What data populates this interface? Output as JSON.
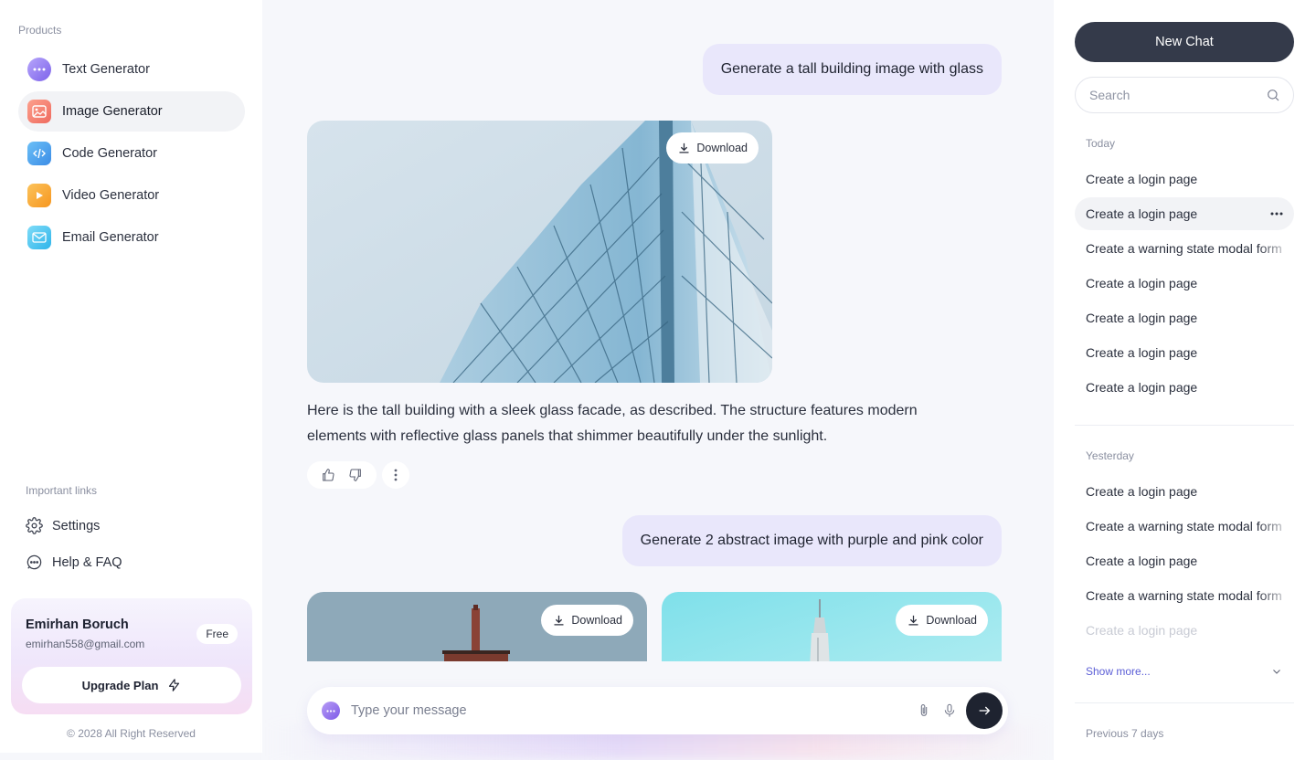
{
  "sidebar": {
    "products_heading": "Products",
    "items": [
      {
        "label": "Text Generator",
        "icon": "chat-bubble-icon",
        "color": "#8f7cf2"
      },
      {
        "label": "Image Generator",
        "icon": "image-icon",
        "color": "#f58a75"
      },
      {
        "label": "Code Generator",
        "icon": "code-icon",
        "color": "#4aa3f0"
      },
      {
        "label": "Video Generator",
        "icon": "video-play-icon",
        "color": "#f8a53a"
      },
      {
        "label": "Email Generator",
        "icon": "mail-icon",
        "color": "#47c4f0"
      }
    ],
    "links_heading": "Important links",
    "links": [
      {
        "label": "Settings",
        "icon": "gear-icon"
      },
      {
        "label": "Help & FAQ",
        "icon": "help-chat-icon"
      }
    ],
    "profile": {
      "name": "Emirhan Boruch",
      "email": "emirhan558@gmail.com",
      "plan": "Free",
      "upgrade_label": "Upgrade Plan"
    },
    "copyright": "© 2028 All Right Reserved"
  },
  "chat": {
    "messages": [
      {
        "role": "user",
        "text": "Generate a tall building image with glass"
      },
      {
        "role": "assistant",
        "text": "Here is the tall building with a sleek glass facade, as described. The structure features modern elements with reflective glass panels that shimmer beautifully under the sunlight."
      },
      {
        "role": "user",
        "text": "Generate 2 abstract image with purple and pink color"
      }
    ],
    "download_label": "Download",
    "composer_placeholder": "Type your message"
  },
  "history": {
    "new_chat_label": "New Chat",
    "search_placeholder": "Search",
    "today_label": "Today",
    "today": [
      "Create a login page",
      "Create a login page",
      "Create a warning state modal form",
      "Create a login page",
      "Create a login page",
      "Create a login page",
      "Create a login page"
    ],
    "yesterday_label": "Yesterday",
    "yesterday": [
      "Create a login page",
      "Create a warning state modal form",
      "Create a login page",
      "Create a warning state modal form",
      "Create a login page"
    ],
    "show_more_label": "Show more...",
    "previous_label": "Previous 7 days"
  },
  "colors": {
    "accent": "#5b5ed6",
    "user_bubble": "#e9e7fb",
    "primary_button": "#343a4a"
  }
}
